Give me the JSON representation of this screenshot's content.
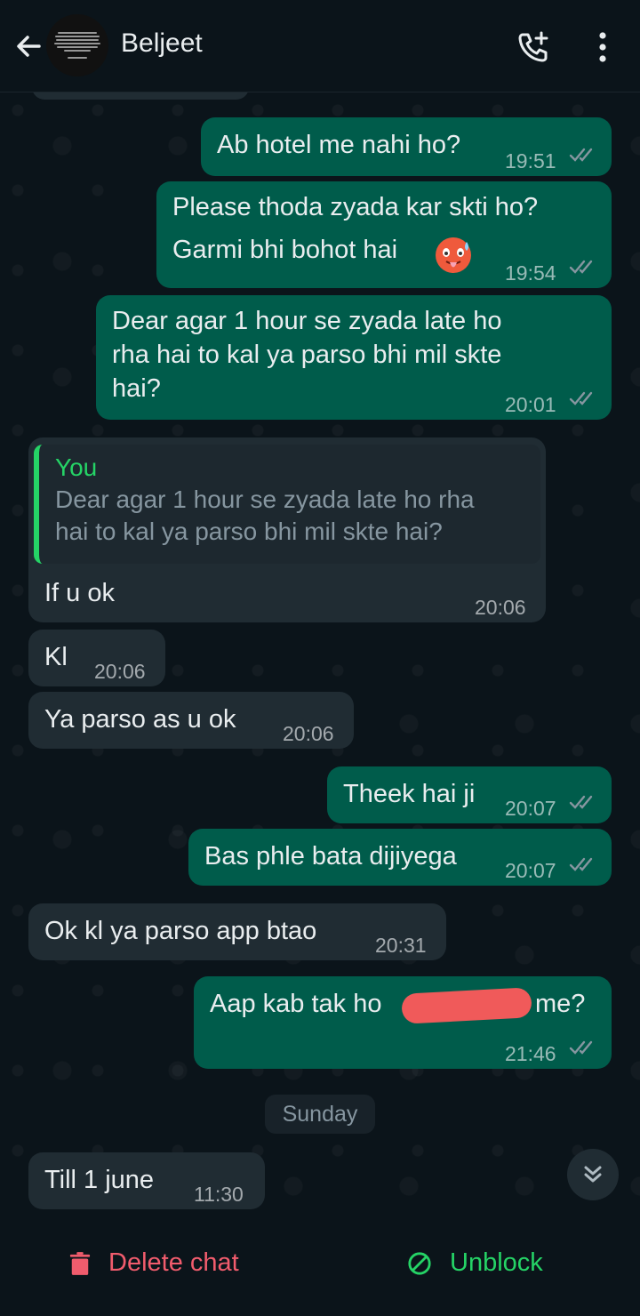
{
  "header": {
    "contact_name": "Beljeet"
  },
  "messages": [
    {
      "text": "Ab hotel me nahi ho?",
      "time": "19:51"
    },
    {
      "line1": "Please thoda zyada kar skti ho?",
      "line2": "Garmi bhi bohot hai",
      "time": "19:54",
      "emoji": "hot-face-emoji"
    },
    {
      "line1": "Dear agar 1 hour se zyada late ho",
      "line2": "rha hai to kal ya parso bhi mil skte",
      "line3": "hai?",
      "time": "20:01"
    },
    {
      "quote_author": "You",
      "quote_line1": "Dear agar 1 hour se zyada late ho rha",
      "quote_line2": "hai to kal ya parso bhi mil skte hai?",
      "text": "If u ok",
      "time": "20:06"
    },
    {
      "text": "Kl",
      "time": "20:06"
    },
    {
      "text": "Ya parso as u ok",
      "time": "20:06"
    },
    {
      "text": "Theek hai ji",
      "time": "20:07"
    },
    {
      "text": "Bas phle bata dijiyega",
      "time": "20:07"
    },
    {
      "text": "Ok kl ya parso app btao",
      "time": "20:31"
    },
    {
      "text_start": "Aap kab tak ho",
      "text_end": "me?",
      "time": "21:46"
    },
    {
      "text": "Till 1 june",
      "time": "11:30"
    }
  ],
  "day_separator": "Sunday",
  "actions": {
    "delete": "Delete chat",
    "unblock": "Unblock"
  },
  "colors": {
    "outgoing": "#005c4b",
    "incoming": "#202c33",
    "accent": "#25d366",
    "danger": "#f15c6d"
  }
}
